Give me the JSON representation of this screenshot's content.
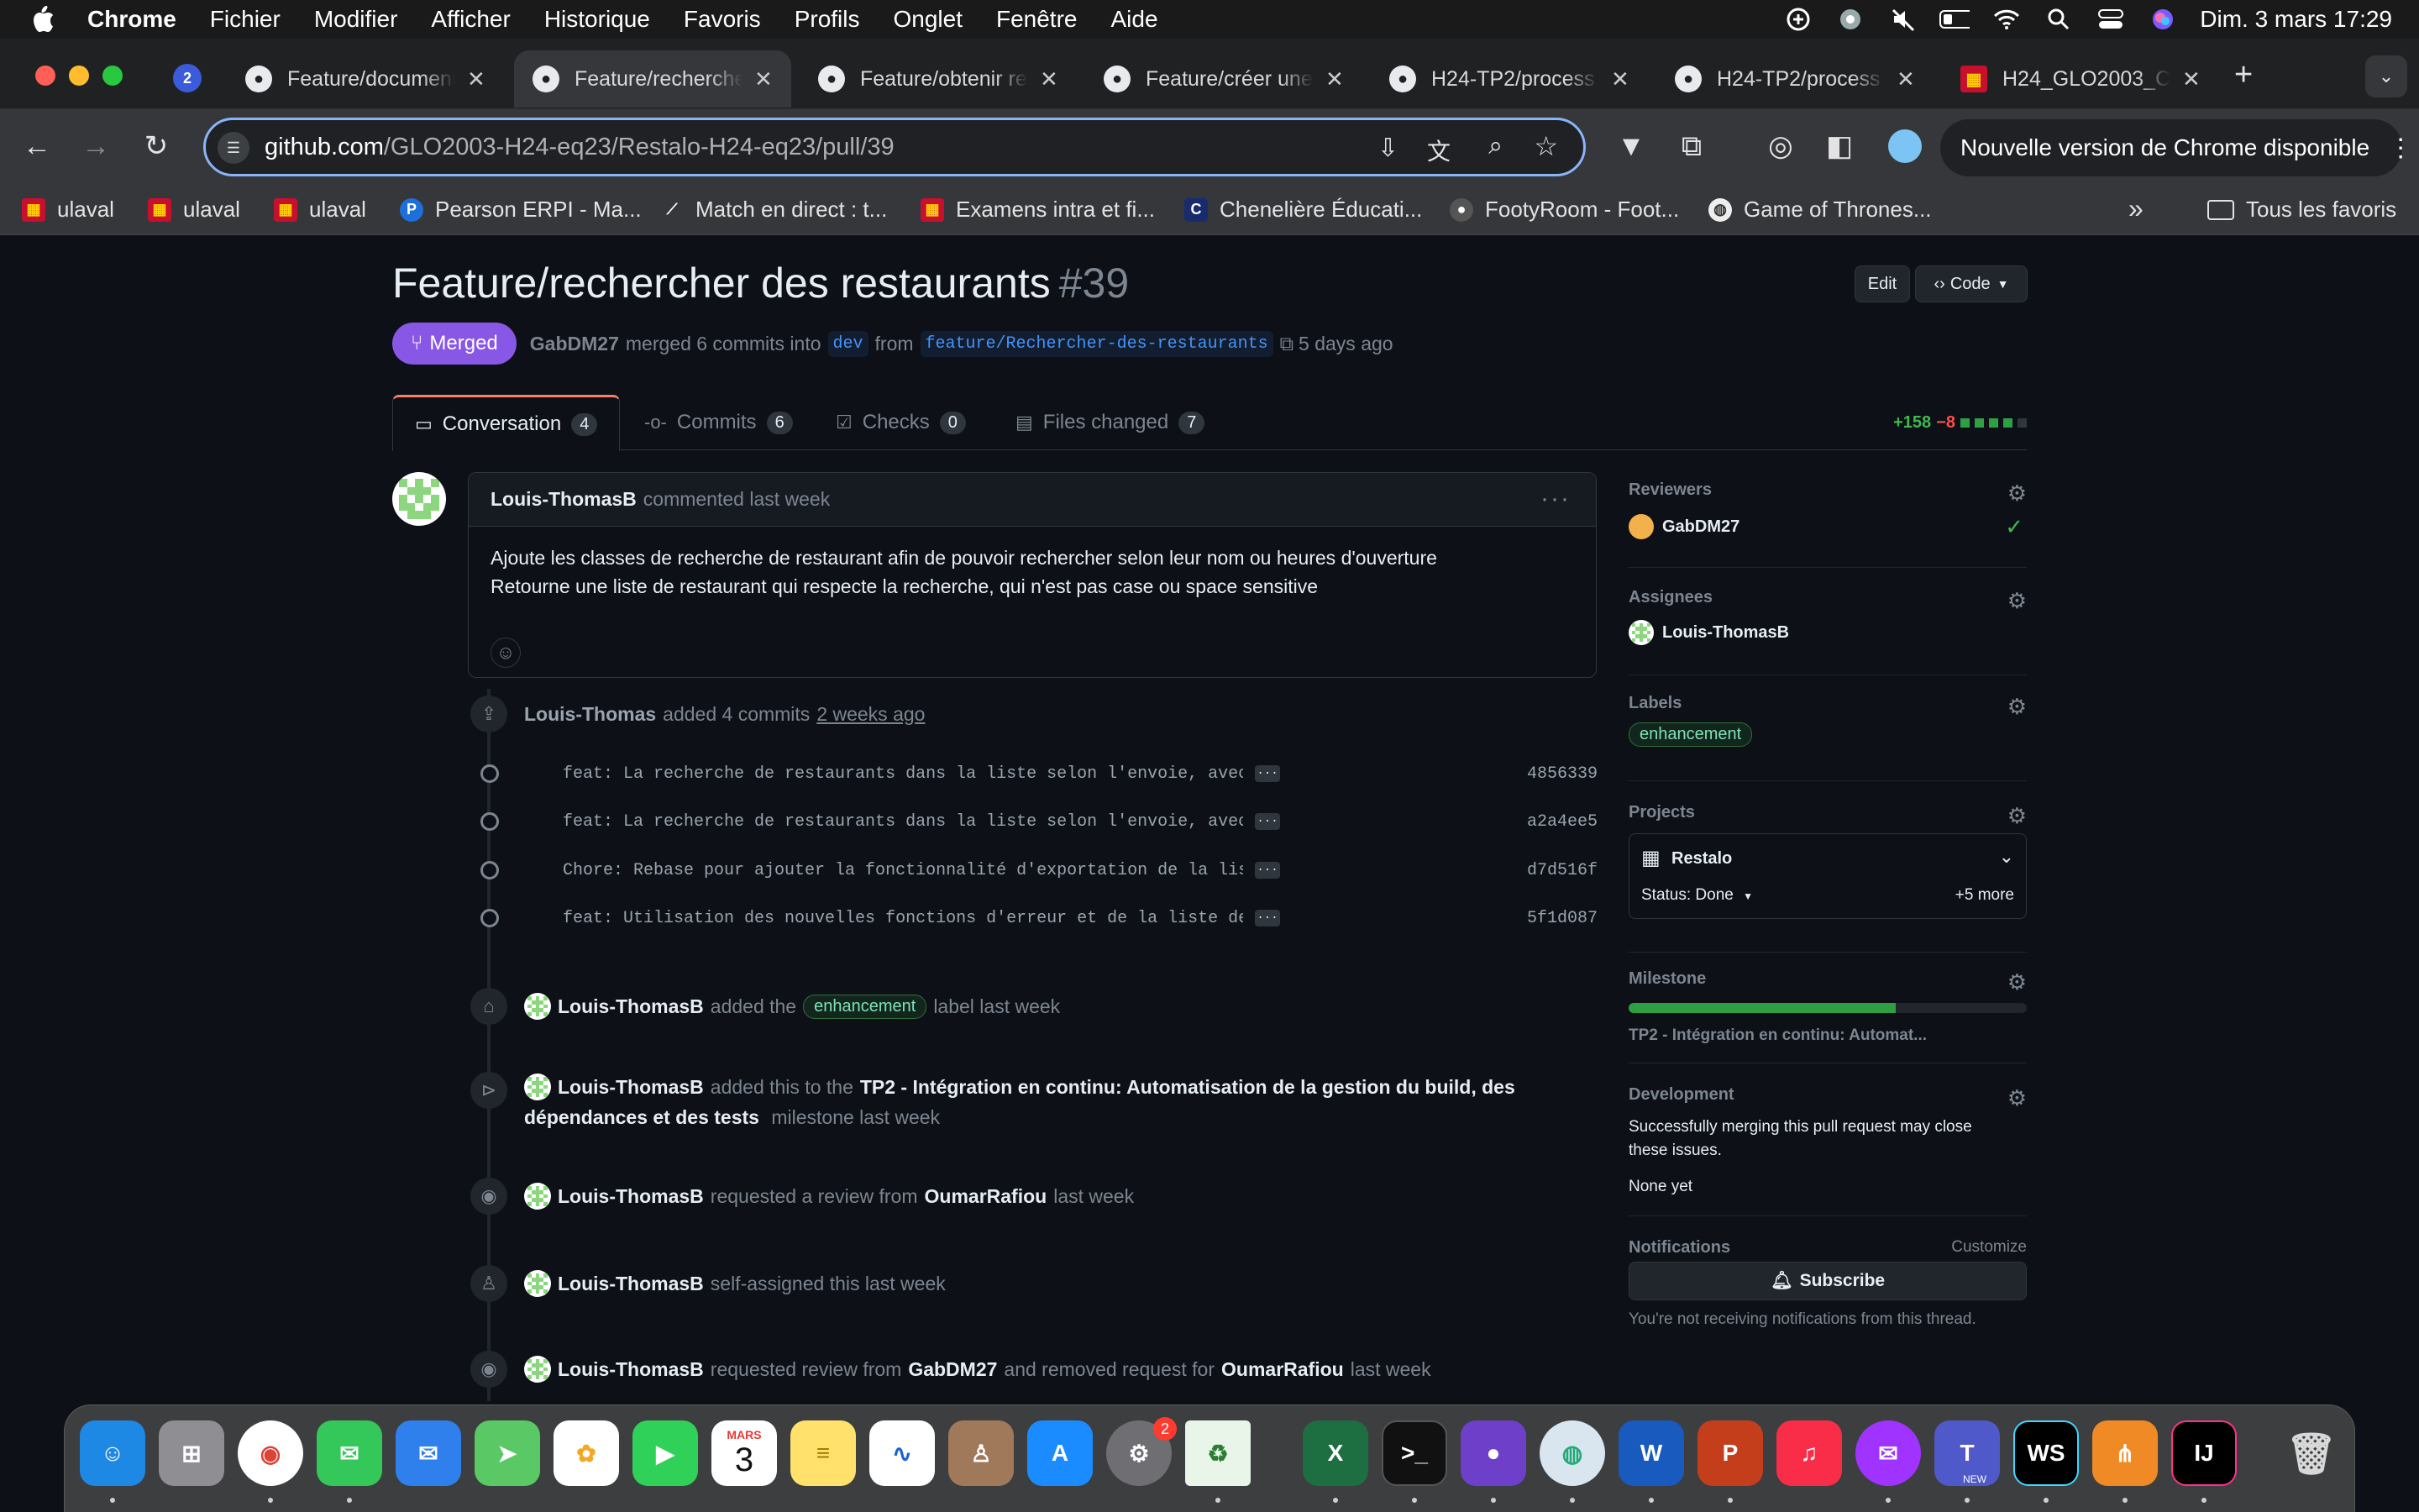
{
  "menubar": {
    "items": [
      "Chrome",
      "Fichier",
      "Modifier",
      "Afficher",
      "Historique",
      "Favoris",
      "Profils",
      "Onglet",
      "Fenêtre",
      "Aide"
    ],
    "datetime": "Dim. 3 mars 17:29"
  },
  "browser": {
    "tabs": [
      {
        "label": "Feature/documenter"
      },
      {
        "label": "Feature/rechercher"
      },
      {
        "label": "Feature/obtenir re"
      },
      {
        "label": "Feature/créer une"
      },
      {
        "label": "H24-TP2/process"
      },
      {
        "label": "H24-TP2/process"
      },
      {
        "label": "H24_GLO2003_C"
      }
    ],
    "url_host": "github.com",
    "url_path": "/GLO2003-H24-eq23/Restalo-H24-eq23/pull/39",
    "update_notice": "Nouvelle version de Chrome disponible",
    "bookmarks": [
      "ulaval",
      "ulaval",
      "ulaval",
      "Pearson ERPI - Ma...",
      "Match en direct : t...",
      "Examens intra et fi...",
      "Chenelière Éducati...",
      "FootyRoom - Foot...",
      "Game of Thrones..."
    ],
    "all_bookmarks": "Tous les favoris"
  },
  "pr": {
    "title": "Feature/rechercher des restaurants",
    "number": "#39",
    "edit_label": "Edit",
    "code_label": "Code",
    "state": "Merged",
    "author": "GabDM27",
    "merge_text": "merged 6 commits into",
    "base": "dev",
    "from_text": "from",
    "head": "feature/Rechercher-des-restaurants",
    "time": "5 days ago"
  },
  "tabs": [
    {
      "label": "Conversation",
      "count": "4"
    },
    {
      "label": "Commits",
      "count": "6"
    },
    {
      "label": "Checks",
      "count": "0"
    },
    {
      "label": "Files changed",
      "count": "7"
    }
  ],
  "diffstat": {
    "additions": "+158",
    "deletions": "−8"
  },
  "comment": {
    "author": "Louis-ThomasB",
    "meta": "commented last week",
    "line1": "Ajoute les classes de recherche de restaurant afin de pouvoir rechercher selon leur nom ou heures d'ouverture",
    "line2": "Retourne une liste de restaurant qui respecte la recherche, qui n'est pas case ou space sensitive"
  },
  "commits_event": {
    "author": "Louis-Thomas",
    "text": "added 4 commits",
    "time": "2 weeks ago"
  },
  "commits": [
    {
      "msg": "feat: La recherche de restaurants dans la liste selon l'envoie, avec …",
      "sha": "4856339"
    },
    {
      "msg": "feat: La recherche de restaurants dans la liste selon l'envoie, avec …",
      "sha": "a2a4ee5"
    },
    {
      "msg": "Chore: Rebase pour ajouter la fonctionnalité d'exportation de la list…",
      "sha": "d7d516f"
    },
    {
      "msg": "feat: Utilisation des nouvelles fonctions d'erreur et de la liste de …",
      "sha": "5f1d087"
    }
  ],
  "events": {
    "label": {
      "author": "Louis-ThomasB",
      "pre": "added the",
      "label": "enhancement",
      "post": "label last week"
    },
    "milestone": {
      "author": "Louis-ThomasB",
      "pre": "added this to the",
      "name1": "TP2 - Intégration en continu: Automatisation de la gestion du build, des",
      "name2": "dépendances et des tests",
      "post": "milestone last week"
    },
    "review1": {
      "author": "Louis-ThomasB",
      "pre": "requested a review from",
      "target": "OumarRafiou",
      "post": "last week"
    },
    "assign": {
      "author": "Louis-ThomasB",
      "text": "self-assigned this last week"
    },
    "review2": {
      "author": "Louis-ThomasB",
      "pre": "requested review from",
      "target": "GabDM27",
      "mid": "and removed request for",
      "target2": "OumarRafiou",
      "post": "last week"
    }
  },
  "sidebar": {
    "reviewers_h": "Reviewers",
    "reviewer": "GabDM27",
    "assignees_h": "Assignees",
    "assignee": "Louis-ThomasB",
    "labels_h": "Labels",
    "label": "enhancement",
    "projects_h": "Projects",
    "project": "Restalo",
    "project_status": "Status: Done",
    "project_more": "+5 more",
    "milestone_h": "Milestone",
    "milestone_progress": 0.67,
    "milestone_name": "TP2 - Intégration en continu: Automat...",
    "development_h": "Development",
    "development_text1": "Successfully merging this pull request may close",
    "development_text2": "these issues.",
    "development_none": "None yet",
    "notifications_h": "Notifications",
    "customize": "Customize",
    "subscribe": "Subscribe",
    "notif_text": "You're not receiving notifications from this thread."
  },
  "dock": {
    "calendar_month": "MARS",
    "calendar_day": "3",
    "settings_badge": "2",
    "teams_badge": "NEW"
  }
}
